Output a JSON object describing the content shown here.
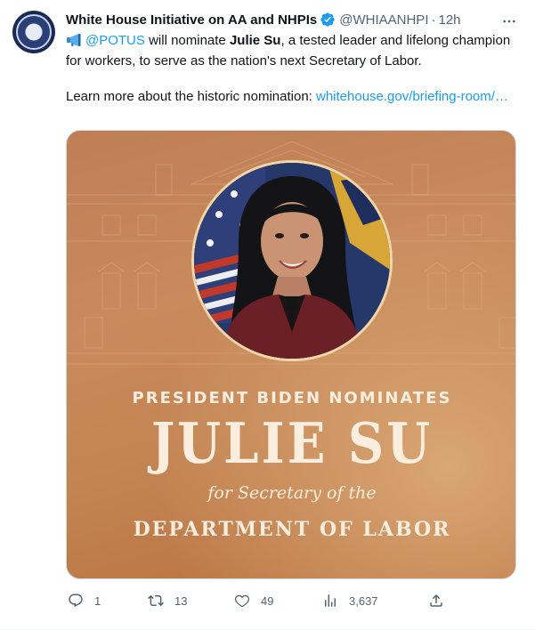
{
  "tweet": {
    "author_name": "White House Initiative on AA and NHPIs",
    "handle": "@WHIAANHPI",
    "separator": "·",
    "time": "12h",
    "text": {
      "mention": "@POTUS",
      "part1": " will nominate ",
      "bold_name": "Julie Su",
      "part2": ", a tested leader and lifelong champion for workers, to serve as the nation's next Secretary of Labor.",
      "learn_more": "Learn more about the historic nomination: ",
      "link": "whitehouse.gov/briefing-room/…"
    },
    "media": {
      "line1": "PRESIDENT BIDEN NOMINATES",
      "line2": "JULIE SU",
      "line3": "for Secretary of the",
      "line4": "DEPARTMENT OF LABOR"
    },
    "actions": {
      "replies": "1",
      "retweets": "13",
      "likes": "49",
      "views": "3,637"
    },
    "icons": {
      "verified": "verified-badge-icon",
      "more": "more-dots-icon",
      "megaphone": "megaphone-emoji-icon",
      "reply": "reply-icon",
      "retweet": "retweet-icon",
      "like": "heart-icon",
      "views": "views-chart-icon",
      "share": "share-icon"
    },
    "colors": {
      "link": "#1d9bf0",
      "secondary_text": "#536471",
      "media_gold": "#c98a5d"
    }
  }
}
